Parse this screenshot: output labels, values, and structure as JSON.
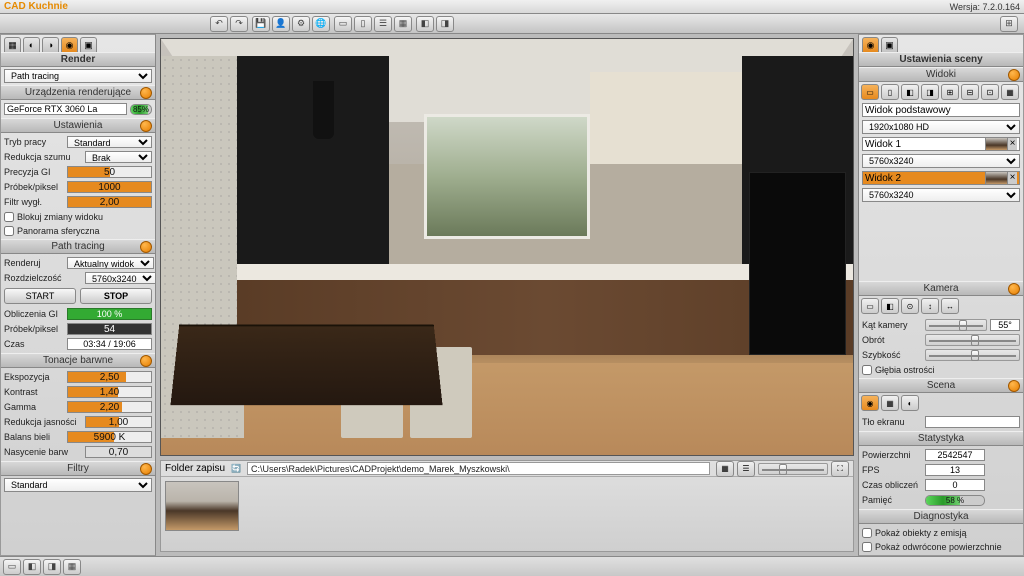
{
  "titlebar": {
    "brand": "CAD Kuchnie",
    "version": "Wersja: 7.2.0.164"
  },
  "render": {
    "title": "Render",
    "method": "Path tracing",
    "devices_hdr": "Urządzenia renderujące",
    "gpu": "GeForce RTX 3060 La",
    "gpu_usage": "85%",
    "settings_hdr": "Ustawienia",
    "mode_lbl": "Tryb pracy",
    "mode": "Standard",
    "denoise_lbl": "Redukcja szumu",
    "denoise": "Brak",
    "gi_lbl": "Precyzja GI",
    "gi": "50",
    "spp_lbl": "Próbek/piksel",
    "spp": "1000",
    "filter_lbl": "Filtr wygł.",
    "filter": "2,00",
    "lock_lbl": "Blokuj zmiany widoku",
    "pano_lbl": "Panorama sferyczna",
    "pt_hdr": "Path tracing",
    "render_lbl": "Renderuj",
    "render_scope": "Aktualny widok",
    "res_lbl": "Rozdzielczość",
    "res": "5760x3240",
    "start": "START",
    "stop": "STOP",
    "calc_gi_lbl": "Obliczenia GI",
    "calc_gi": "100 %",
    "spp2_lbl": "Próbek/piksel",
    "spp2": "54",
    "time_lbl": "Czas",
    "time": "03:34 / 19:06",
    "tone_hdr": "Tonacje barwne",
    "expo_lbl": "Ekspozycja",
    "expo": "2,50",
    "contrast_lbl": "Kontrast",
    "contrast": "1,40",
    "gamma_lbl": "Gamma",
    "gamma": "2,20",
    "bright_lbl": "Redukcja jasności",
    "bright": "1,00",
    "wb_lbl": "Balans bieli",
    "wb": "5900 K",
    "sat_lbl": "Nasycenie barw",
    "sat": "0,70",
    "filters_hdr": "Filtry",
    "filters_val": "Standard"
  },
  "views": {
    "scene_title": "Ustawienia sceny",
    "views_hdr": "Widoki",
    "v0_lbl": "Widok podstawowy",
    "v0_res": "1920x1080 HD",
    "v1_lbl": "Widok 1",
    "v1_res": "5760x3240",
    "v2_lbl": "Widok 2",
    "v2_res": "5760x3240"
  },
  "camera": {
    "hdr": "Kamera",
    "angle_lbl": "Kąt kamery",
    "angle": "55°",
    "rot_lbl": "Obrót",
    "speed_lbl": "Szybkość",
    "dof_lbl": "Głębia ostrości"
  },
  "scene": {
    "hdr": "Scena",
    "bg_lbl": "Tło ekranu"
  },
  "stats": {
    "hdr": "Statystyka",
    "faces_lbl": "Powierzchni",
    "faces": "2542547",
    "fps_lbl": "FPS",
    "fps": "13",
    "calc_lbl": "Czas obliczeń",
    "calc": "0",
    "mem_lbl": "Pamięć",
    "mem": "58 %"
  },
  "diag": {
    "hdr": "Diagnostyka",
    "emit_lbl": "Pokaż obiekty z emisją",
    "flip_lbl": "Pokaż odwrócone powierzchnie"
  },
  "thumbbar": {
    "folder_lbl": "Folder zapisu",
    "path": "C:\\Users\\Radek\\Pictures\\CADProjekt\\demo_Marek_Myszkowski\\"
  }
}
